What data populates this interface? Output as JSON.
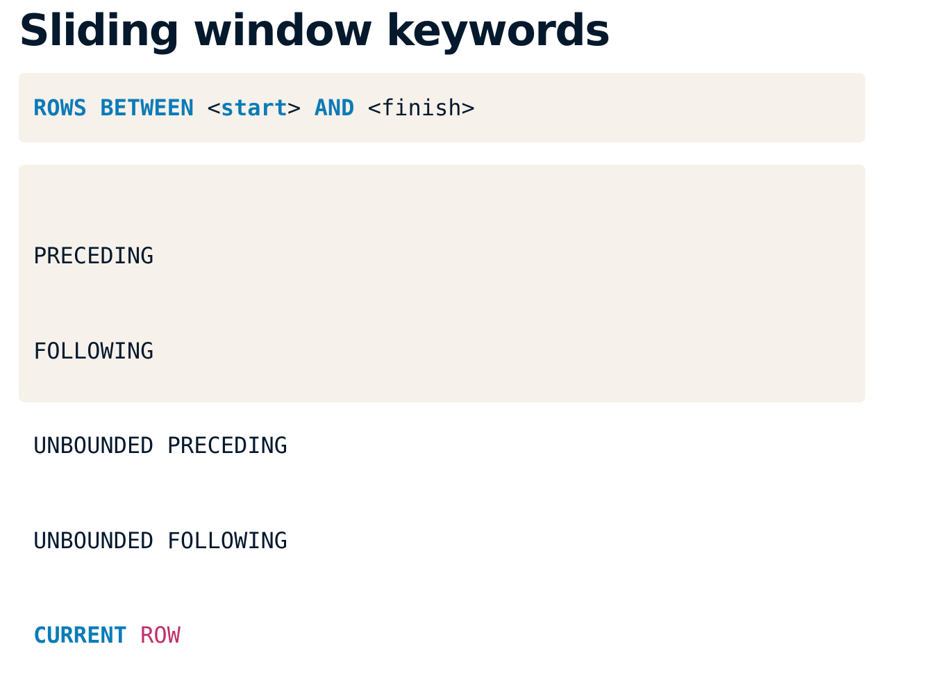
{
  "title": "Sliding window keywords",
  "syntax": {
    "rows": "ROWS",
    "between": "BETWEEN",
    "lt1": "<",
    "start": "start",
    "gt1": ">",
    "and": "AND",
    "finish": "<finish>"
  },
  "keywords": {
    "items": [
      "PRECEDING",
      "FOLLOWING",
      "UNBOUNDED PRECEDING",
      "UNBOUNDED FOLLOWING"
    ],
    "current": "CURRENT",
    "row": "ROW"
  },
  "colors": {
    "keyword": "#0a7bb8",
    "highlight": "#c0306d",
    "text": "#05192d",
    "code_background": "#f6f1ea"
  }
}
